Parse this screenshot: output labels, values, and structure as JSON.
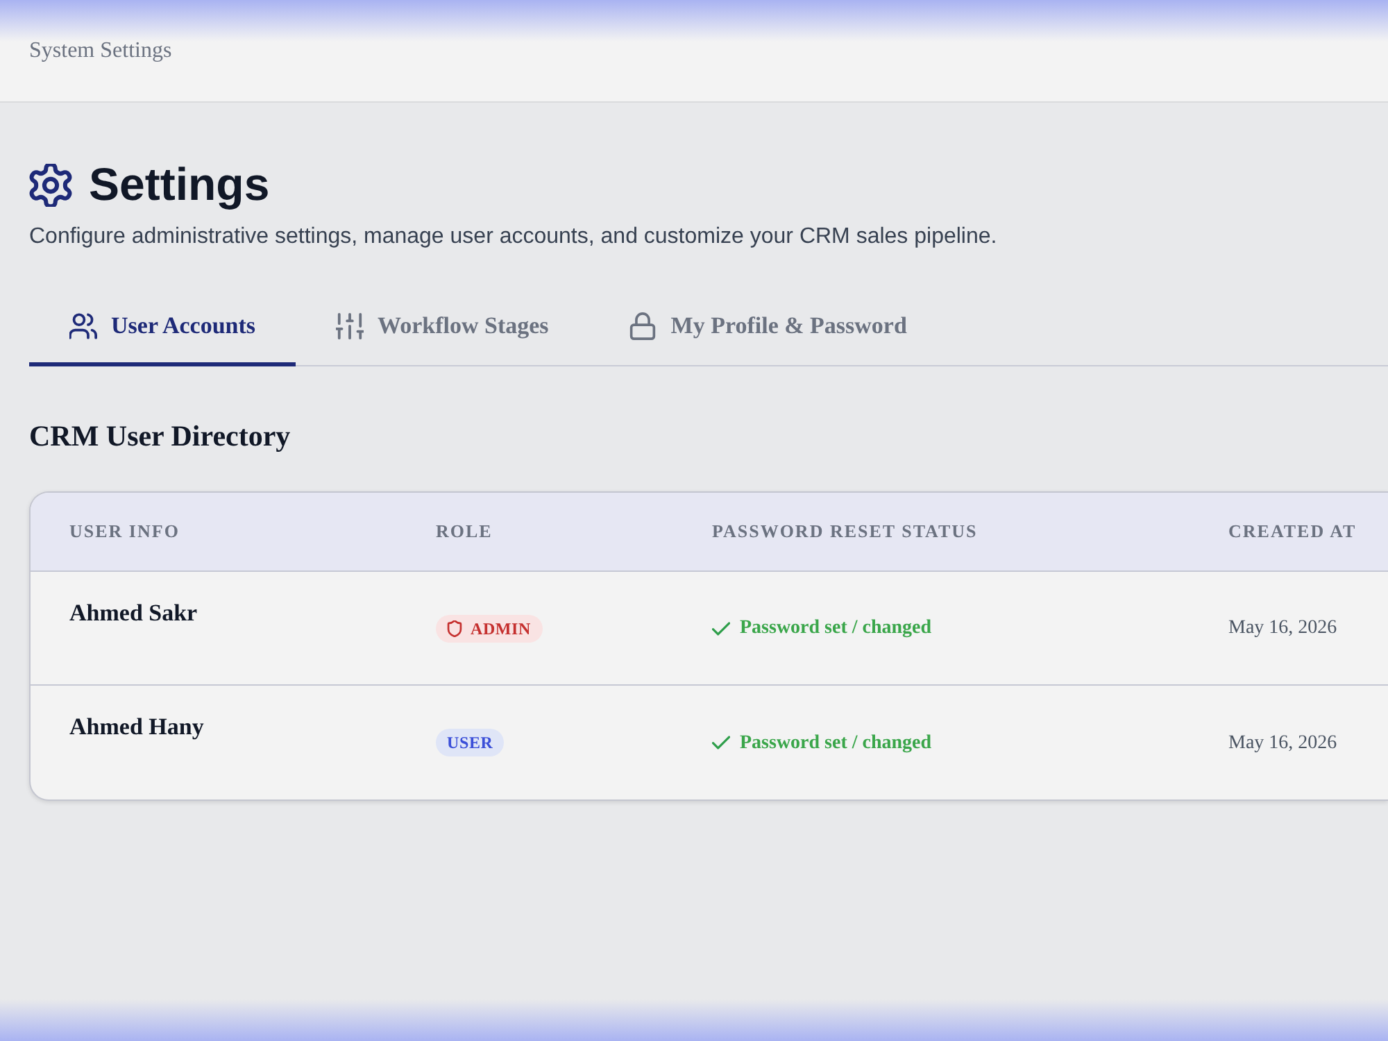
{
  "header": {
    "title": "System Settings"
  },
  "page": {
    "title": "Settings",
    "subtitle": "Configure administrative settings, manage user accounts, and customize your CRM sales pipeline."
  },
  "tabs": [
    {
      "label": "User Accounts",
      "selected": true
    },
    {
      "label": "Workflow Stages",
      "selected": false
    },
    {
      "label": "My Profile & Password",
      "selected": false
    }
  ],
  "section": {
    "title": "CRM User Directory"
  },
  "table": {
    "columns": [
      "USER INFO",
      "ROLE",
      "PASSWORD RESET STATUS",
      "CREATED AT"
    ],
    "rows": [
      {
        "name": "Ahmed Sakr",
        "role": {
          "label": "ADMIN",
          "kind": "admin"
        },
        "password_status": "Password set / changed",
        "created_at": "May 16, 2026"
      },
      {
        "name": "Ahmed Hany",
        "role": {
          "label": "USER",
          "kind": "user"
        },
        "password_status": "Password set / changed",
        "created_at": "May 16, 2026"
      }
    ]
  }
}
